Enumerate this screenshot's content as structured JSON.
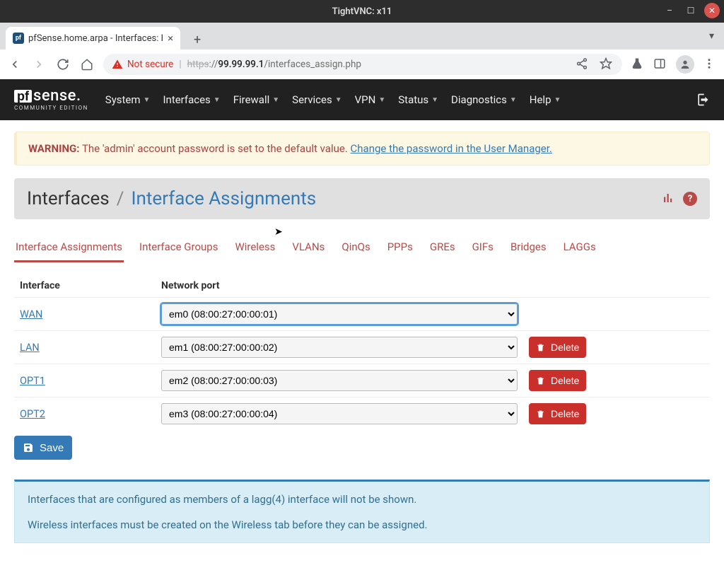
{
  "window": {
    "title": "TightVNC: x11"
  },
  "browser": {
    "tab_title": "pfSense.home.arpa - Interfaces: I",
    "not_secure": "Not secure",
    "url_scheme": "https",
    "url_host": "99.99.99.1",
    "url_path": "/interfaces_assign.php"
  },
  "nav": {
    "items": [
      "System",
      "Interfaces",
      "Firewall",
      "Services",
      "VPN",
      "Status",
      "Diagnostics",
      "Help"
    ],
    "brand_sub": "COMMUNITY EDITION"
  },
  "alert": {
    "lead": "WARNING:",
    "text": "The 'admin' account password is set to the default value.",
    "link": "Change the password in the User Manager."
  },
  "header": {
    "crumb": "Interfaces",
    "sep": "/",
    "current": "Interface Assignments"
  },
  "tabs": [
    "Interface Assignments",
    "Interface Groups",
    "Wireless",
    "VLANs",
    "QinQs",
    "PPPs",
    "GREs",
    "GIFs",
    "Bridges",
    "LAGGs"
  ],
  "table": {
    "col_if": "Interface",
    "col_port": "Network port",
    "rows": [
      {
        "name": "WAN",
        "port": "em0 (08:00:27:00:00:01)",
        "deletable": false,
        "focused": true
      },
      {
        "name": "LAN",
        "port": "em1 (08:00:27:00:00:02)",
        "deletable": true,
        "focused": false
      },
      {
        "name": "OPT1",
        "port": "em2 (08:00:27:00:00:03)",
        "deletable": true,
        "focused": false
      },
      {
        "name": "OPT2",
        "port": "em3 (08:00:27:00:00:04)",
        "deletable": true,
        "focused": false
      }
    ],
    "delete_label": "Delete",
    "save_label": "Save"
  },
  "info": {
    "line1": "Interfaces that are configured as members of a lagg(4) interface will not be shown.",
    "line2": "Wireless interfaces must be created on the Wireless tab before they can be assigned."
  }
}
